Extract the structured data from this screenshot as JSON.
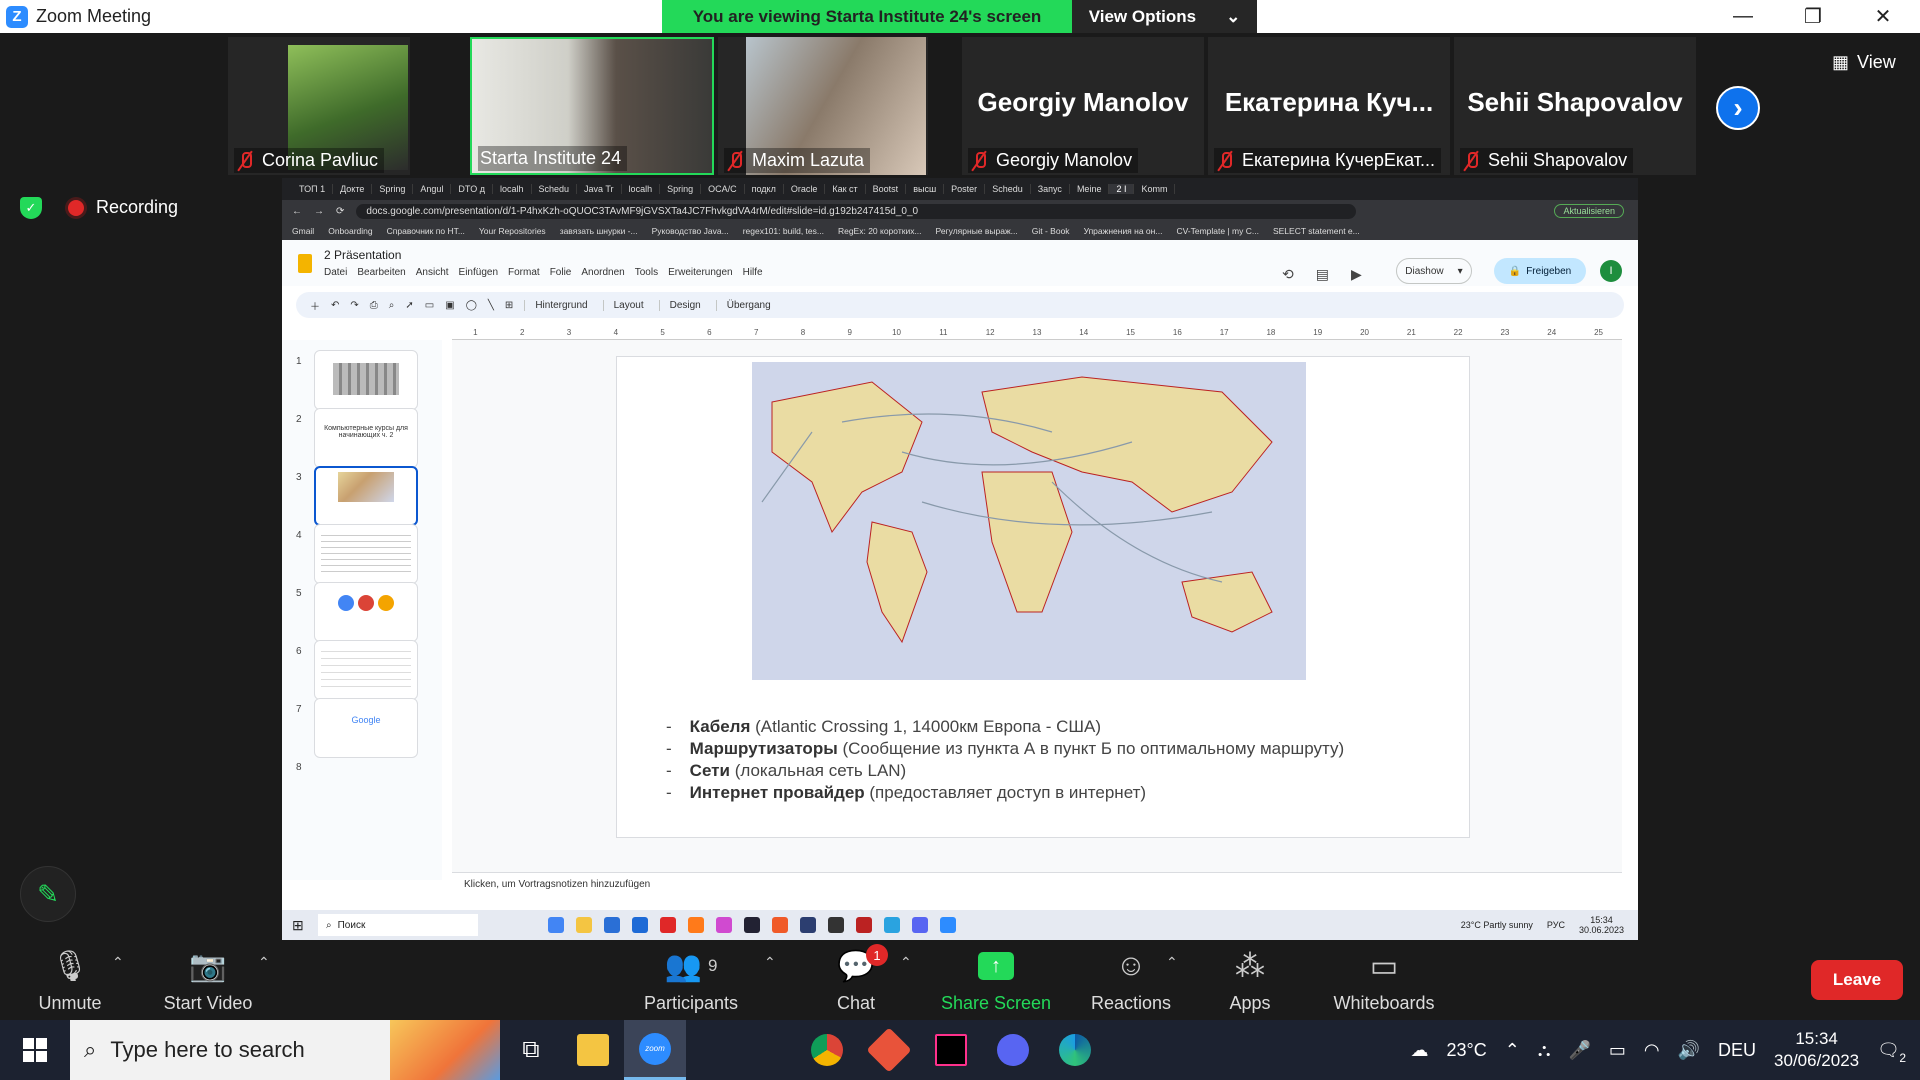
{
  "zoom": {
    "window_title": "Zoom Meeting",
    "share_banner": "You are viewing Starta Institute 24's screen",
    "view_options": "View Options",
    "view_button": "View",
    "recording": "Recording",
    "participants": [
      {
        "name": "Corina Pavliuc",
        "muted": true
      },
      {
        "name": "Starta Institute 24",
        "muted": false
      },
      {
        "name": "Maxim Lazuta",
        "muted": true
      },
      {
        "name": "Georgiy Manolov",
        "big": "Georgiy Manolov",
        "muted": true
      },
      {
        "name": "Екатерина КучерЕкат...",
        "big": "Екатерина  Куч...",
        "muted": true
      },
      {
        "name": "Sehii Shapovalov",
        "big": "Sehii Shapovalov",
        "muted": true
      }
    ],
    "controls": {
      "unmute": "Unmute",
      "start_video": "Start Video",
      "participants": "Participants",
      "participants_count": "9",
      "chat": "Chat",
      "chat_badge": "1",
      "share_screen": "Share Screen",
      "reactions": "Reactions",
      "apps": "Apps",
      "whiteboards": "Whiteboards",
      "leave": "Leave"
    }
  },
  "browser": {
    "tabs": [
      "ТОП 1",
      "Докте",
      "Spring",
      "Angul",
      "DTO д",
      "localh",
      "Schedu",
      "Java Tr",
      "localh",
      "Spring",
      "OCA/C",
      "подкл",
      "Oracle",
      "Как ст",
      "Bootst",
      "высш",
      "Poster",
      "Schedu",
      "Запус",
      "Meine",
      "2 I",
      "Komm"
    ],
    "url": "docs.google.com/presentation/d/1-P4hxKzh-oQUOC3TAvMF9jGVSXTa4JC7FhvkgdVA4rM/edit#slide=id.g192b247415d_0_0",
    "update_button": "Aktualisieren",
    "bookmarks": [
      "Gmail",
      "Onboarding",
      "Справочник по HT...",
      "Your Repositories",
      "завязать шнурки -...",
      "Руководство Java...",
      "regex101: build, tes...",
      "RegEx: 20 коротких...",
      "Регулярные выраж...",
      "Git - Book",
      "Упражнения на он...",
      "CV-Template | my C...",
      "SELECT statement e..."
    ]
  },
  "slides": {
    "doc_title": "2 Präsentation",
    "menu": [
      "Datei",
      "Bearbeiten",
      "Ansicht",
      "Einfügen",
      "Format",
      "Folie",
      "Anordnen",
      "Tools",
      "Erweiterungen",
      "Hilfe"
    ],
    "diashow": "Diashow",
    "share": "Freigeben",
    "avatar_letter": "I",
    "toolbar_words": [
      "Hintergrund",
      "Layout",
      "Design",
      "Übergang"
    ],
    "ruler": [
      "1",
      "2",
      "3",
      "4",
      "5",
      "6",
      "7",
      "8",
      "9",
      "10",
      "11",
      "12",
      "13",
      "14",
      "15",
      "16",
      "17",
      "18",
      "19",
      "20",
      "21",
      "22",
      "23",
      "24",
      "25"
    ],
    "thumb_numbers": [
      "1",
      "2",
      "3",
      "4",
      "5",
      "6",
      "7",
      "8"
    ],
    "thumb2_text": "Компьютерные курсы для начинающих ч. 2",
    "thumb7_text": "Google",
    "bullets": [
      {
        "bold": "Кабеля",
        "rest": " (Atlantic Crossing 1, 14000км Европа - США)"
      },
      {
        "bold": "Маршрутизаторы",
        "rest": " (Сообщение из пункта А в пункт Б по оптимальному маршруту)"
      },
      {
        "bold": "Сети",
        "rest": " (локальная сеть LAN)"
      },
      {
        "bold": "Интернет провайдер",
        "rest": " (предоставляет доступ в интернет)"
      }
    ],
    "notes_placeholder": "Klicken, um Vortragsnotizen hinzuzufügen"
  },
  "inner_taskbar": {
    "search": "Поиск",
    "weather": "23°C  Partly sunny",
    "lang": "РУС",
    "time": "15:34",
    "date": "30.06.2023"
  },
  "taskbar": {
    "search_placeholder": "Type here to search",
    "zoom_label": "zoom",
    "temperature": "23°C",
    "language": "DEU",
    "time": "15:34",
    "date": "30/06/2023",
    "notifications": "2"
  }
}
